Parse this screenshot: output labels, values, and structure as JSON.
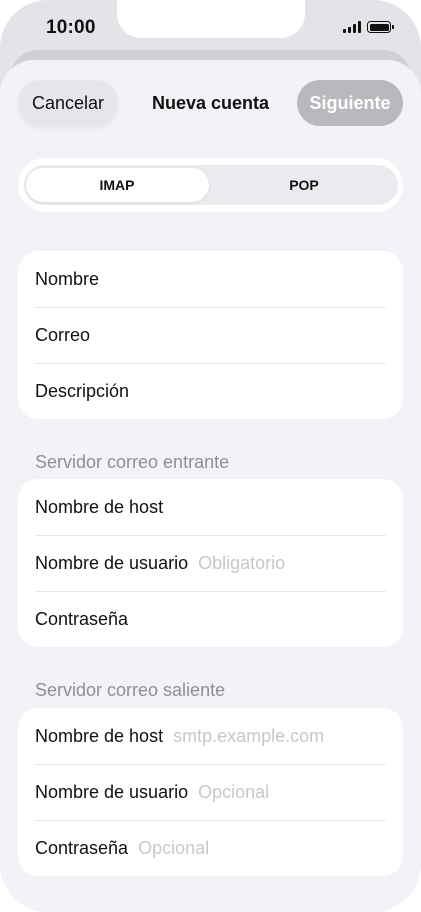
{
  "status_bar": {
    "time": "10:00"
  },
  "nav": {
    "cancel_label": "Cancelar",
    "title": "Nueva cuenta",
    "next_label": "Siguiente"
  },
  "segmented": {
    "imap": "IMAP",
    "pop": "POP",
    "selected": "IMAP"
  },
  "account": {
    "name_label": "Nombre",
    "email_label": "Correo",
    "description_label": "Descripción"
  },
  "incoming": {
    "header": "Servidor correo entrante",
    "host_label": "Nombre de host",
    "user_label": "Nombre de usuario",
    "user_placeholder": "Obligatorio",
    "password_label": "Contraseña"
  },
  "outgoing": {
    "header": "Servidor correo saliente",
    "host_label": "Nombre de host",
    "host_placeholder": "smtp.example.com",
    "user_label": "Nombre de usuario",
    "user_placeholder": "Opcional",
    "password_label": "Contraseña",
    "password_placeholder": "Opcional"
  },
  "colors": {
    "background": "#f2f2f7",
    "group": "#ffffff",
    "separator": "#e5e5ea",
    "secondary_text": "#8e8e93",
    "placeholder": "#c7c7cc",
    "disabled_button": "#b8b8bd"
  },
  "icons": [
    "cellular-signal-icon",
    "battery-icon"
  ]
}
